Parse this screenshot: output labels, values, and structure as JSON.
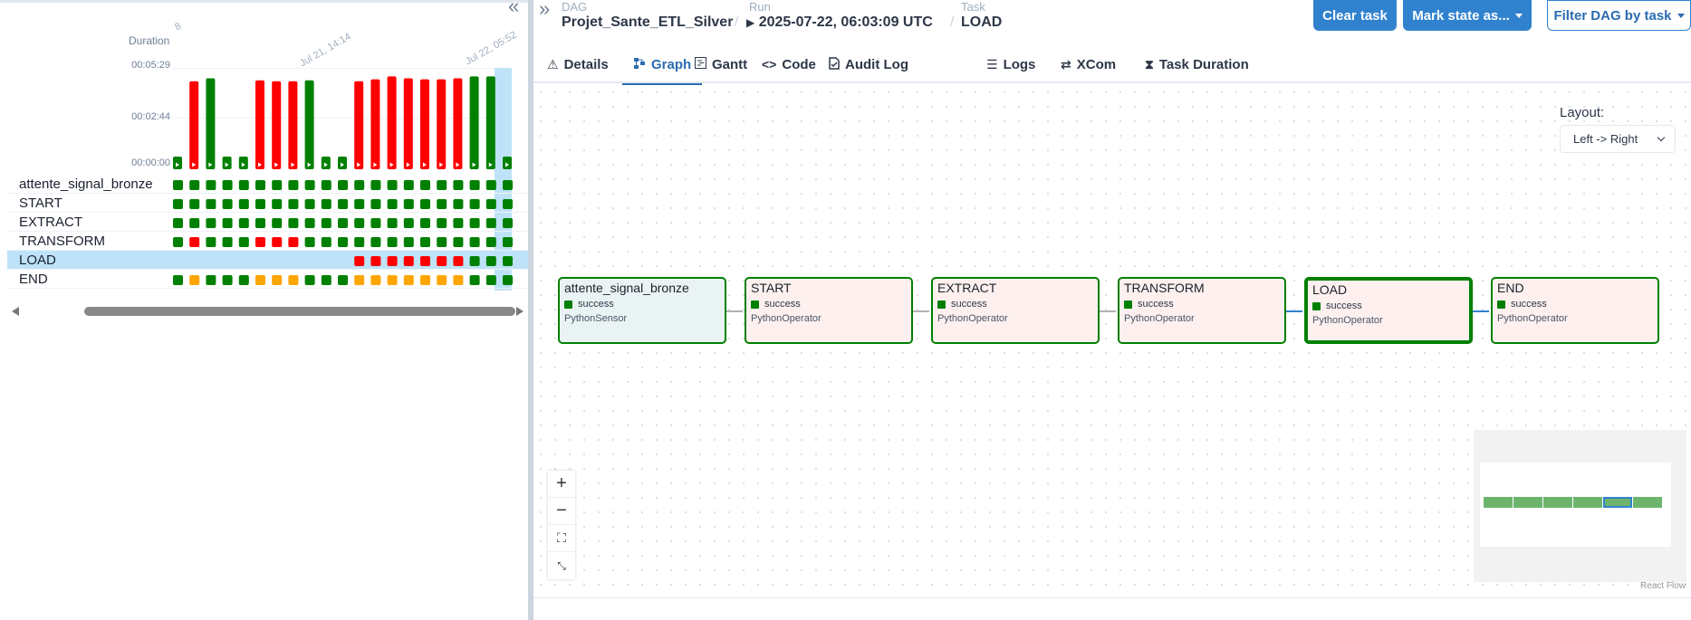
{
  "left_panel": {
    "collapse_icon": "double-chevron-left-icon",
    "date_labels": [
      "Jul 21, 14:14",
      "Jul 22, 05:52"
    ],
    "date_partial": "8",
    "duration_label": "Duration",
    "y_ticks": [
      "00:05:29",
      "00:02:44",
      "00:00:00"
    ],
    "runs": [
      {
        "state": "success",
        "duration": 0.0
      },
      {
        "state": "failed",
        "duration": 0.9
      },
      {
        "state": "success",
        "duration": 0.93
      },
      {
        "state": "success",
        "duration": 0.0
      },
      {
        "state": "success",
        "duration": 0.0
      },
      {
        "state": "failed",
        "duration": 0.91
      },
      {
        "state": "failed",
        "duration": 0.9
      },
      {
        "state": "failed",
        "duration": 0.9
      },
      {
        "state": "success",
        "duration": 0.91
      },
      {
        "state": "success",
        "duration": 0.0
      },
      {
        "state": "success",
        "duration": 0.0
      },
      {
        "state": "failed",
        "duration": 0.9
      },
      {
        "state": "failed",
        "duration": 0.92
      },
      {
        "state": "failed",
        "duration": 0.95
      },
      {
        "state": "failed",
        "duration": 0.93
      },
      {
        "state": "failed",
        "duration": 0.92
      },
      {
        "state": "failed",
        "duration": 0.92
      },
      {
        "state": "failed",
        "duration": 0.93
      },
      {
        "state": "success",
        "duration": 0.95
      },
      {
        "state": "success",
        "duration": 0.95
      },
      {
        "state": "success",
        "duration": 0.0
      }
    ],
    "tasks": [
      {
        "name": "attente_signal_bronze",
        "states": [
          "success",
          "success",
          "success",
          "success",
          "success",
          "success",
          "success",
          "success",
          "success",
          "success",
          "success",
          "success",
          "success",
          "success",
          "success",
          "success",
          "success",
          "success",
          "success",
          "success",
          "success"
        ]
      },
      {
        "name": "START",
        "states": [
          "success",
          "success",
          "success",
          "success",
          "success",
          "success",
          "success",
          "success",
          "success",
          "success",
          "success",
          "success",
          "success",
          "success",
          "success",
          "success",
          "success",
          "success",
          "success",
          "success",
          "success"
        ]
      },
      {
        "name": "EXTRACT",
        "states": [
          "success",
          "success",
          "success",
          "success",
          "success",
          "success",
          "success",
          "success",
          "success",
          "success",
          "success",
          "success",
          "success",
          "success",
          "success",
          "success",
          "success",
          "success",
          "success",
          "success",
          "success"
        ]
      },
      {
        "name": "TRANSFORM",
        "states": [
          "success",
          "failed",
          "success",
          "success",
          "success",
          "failed",
          "failed",
          "failed",
          "success",
          "success",
          "success",
          "success",
          "success",
          "success",
          "success",
          "success",
          "success",
          "success",
          "success",
          "success",
          "success"
        ]
      },
      {
        "name": "LOAD",
        "states": [
          "none",
          "none",
          "none",
          "none",
          "none",
          "none",
          "none",
          "none",
          "none",
          "none",
          "none",
          "failed",
          "failed",
          "failed",
          "failed",
          "failed",
          "failed",
          "failed",
          "success",
          "success",
          "success"
        ]
      },
      {
        "name": "END",
        "states": [
          "success",
          "upstream_failed",
          "success",
          "success",
          "success",
          "upstream_failed",
          "upstream_failed",
          "upstream_failed",
          "success",
          "success",
          "success",
          "upstream_failed",
          "upstream_failed",
          "upstream_failed",
          "upstream_failed",
          "upstream_failed",
          "upstream_failed",
          "upstream_failed",
          "success",
          "success",
          "success"
        ]
      }
    ],
    "selected_task": "LOAD"
  },
  "colors": {
    "success": "#008000",
    "failed": "#ff0000",
    "upstream_failed": "#ffa500",
    "accent": "#3182ce",
    "selected_row": "#bee3f8",
    "edge_active": "#3182ce",
    "edge_inactive": "#b1b1b7"
  },
  "header": {
    "expand_icon": "double-chevron-right-icon",
    "dag_label": "DAG",
    "dag_value": "Projet_Sante_ETL_Silver",
    "run_label": "Run",
    "run_value": "2025-07-22, 06:03:09 UTC",
    "task_label": "Task",
    "task_value": "LOAD",
    "clear_task": "Clear task",
    "mark_state": "Mark state as...",
    "filter_dag": "Filter DAG by task"
  },
  "tabs": [
    {
      "label": "Details",
      "icon": "warning-triangle-icon"
    },
    {
      "label": "Graph",
      "icon": "graph-icon"
    },
    {
      "label": "Gantt",
      "icon": "gantt-icon"
    },
    {
      "label": "Code",
      "icon": "code-icon"
    },
    {
      "label": "Audit Log",
      "icon": "audit-log-icon"
    },
    {
      "label": "Logs",
      "icon": "logs-icon"
    },
    {
      "label": "XCom",
      "icon": "xcom-icon"
    },
    {
      "label": "Task Duration",
      "icon": "hourglass-icon"
    }
  ],
  "active_tab": "Graph",
  "graph": {
    "layout_label": "Layout:",
    "layout_value": "Left -> Right",
    "nodes": [
      {
        "name": "attente_signal_bronze",
        "state": "success",
        "operator": "PythonSensor",
        "bg": "#eaf3f3"
      },
      {
        "name": "START",
        "state": "success",
        "operator": "PythonOperator",
        "bg": "#fdf0ee"
      },
      {
        "name": "EXTRACT",
        "state": "success",
        "operator": "PythonOperator",
        "bg": "#fdf0ee"
      },
      {
        "name": "TRANSFORM",
        "state": "success",
        "operator": "PythonOperator",
        "bg": "#fdf0ee"
      },
      {
        "name": "LOAD",
        "state": "success",
        "operator": "PythonOperator",
        "bg": "#fdf0ee"
      },
      {
        "name": "END",
        "state": "success",
        "operator": "PythonOperator",
        "bg": "#fdf0ee"
      }
    ],
    "selected_node": "LOAD",
    "zoom_in": "+",
    "zoom_out": "−",
    "fit_view": "⛶",
    "fullscreen": "⤡",
    "attribution": "React Flow"
  }
}
